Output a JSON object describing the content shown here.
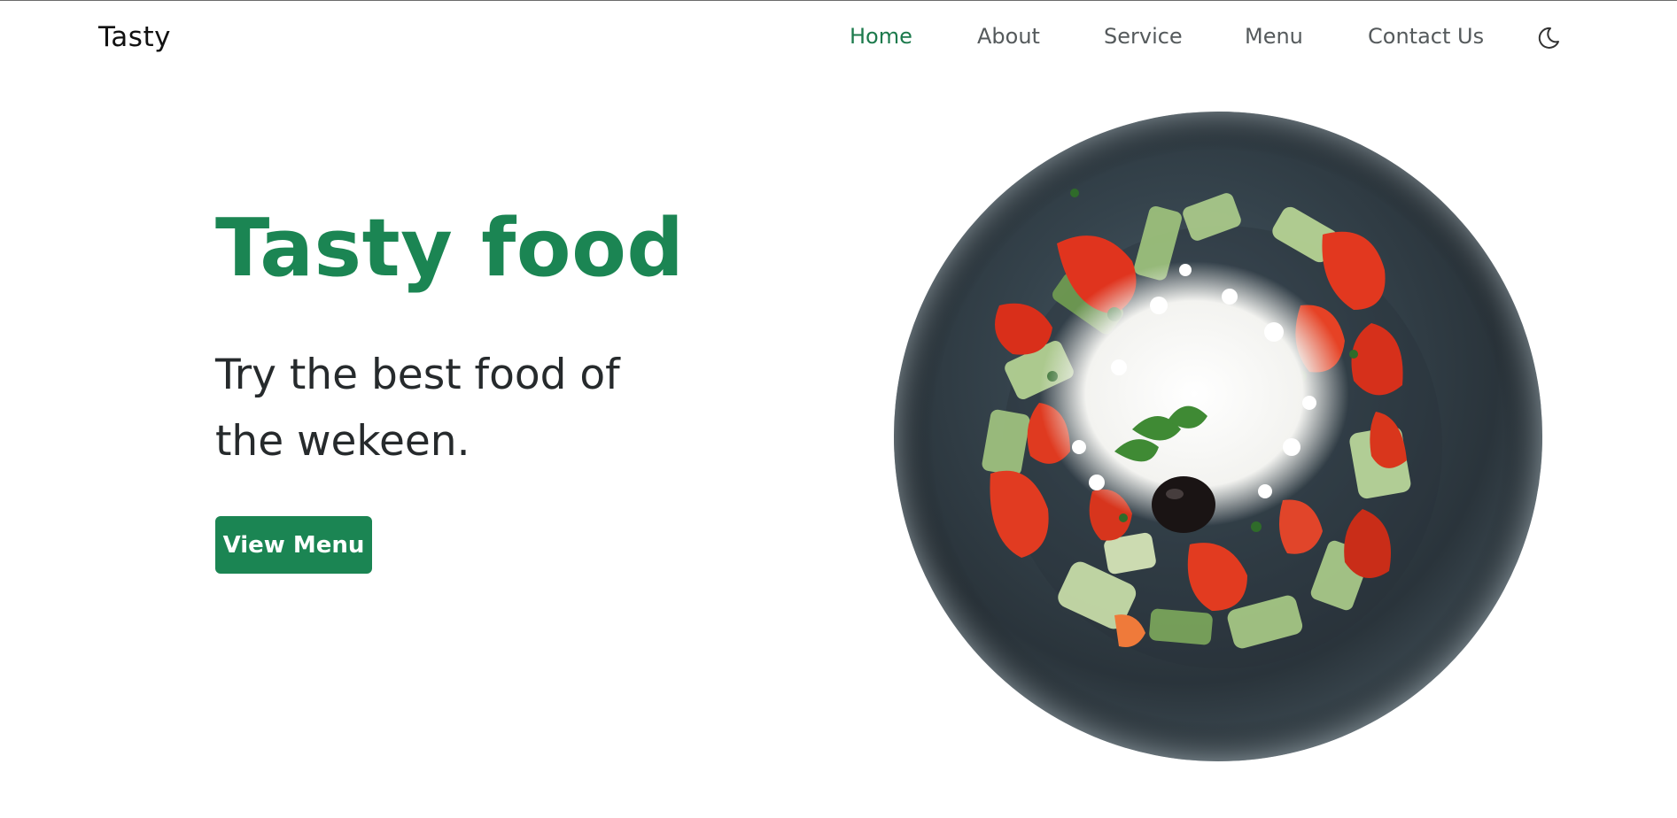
{
  "header": {
    "logo": "Tasty",
    "nav": [
      {
        "label": "Home",
        "active": true
      },
      {
        "label": "About",
        "active": false
      },
      {
        "label": "Service",
        "active": false
      },
      {
        "label": "Menu",
        "active": false
      },
      {
        "label": "Contact Us",
        "active": false
      }
    ],
    "theme_icon": "moon-icon"
  },
  "hero": {
    "title": "Tasty food",
    "subtitle": "Try the best food of the wekeen.",
    "button_label": "View Menu",
    "image_icon": "salad-plate-image"
  },
  "colors": {
    "accent": "#1b8553",
    "text_dark": "#262a2c",
    "nav_text": "#555a5c",
    "background": "#ffffff"
  }
}
